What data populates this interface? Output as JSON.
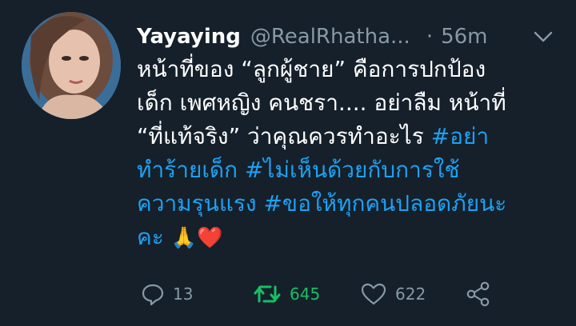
{
  "tweet": {
    "author_name": "Yayaying",
    "handle": "@RealRhatha...",
    "separator": "·",
    "time": "56m",
    "lines": [
      {
        "text": "หน้าที่ของ “ลูกผู้ชาย” คือการปกป้อง"
      },
      {
        "text": "เด็ก เพศหญิง คนชรา.... อย่าลืม หน้าที่"
      },
      {
        "text": "“ที่แท้จริง” ว่าคุณควรทำอะไร ",
        "tag": "#อย่า"
      },
      {
        "tag": "ทำร้ายเด็ก #ไม่เห็นด้วยกับการใช้"
      },
      {
        "tag": "ความรุนแรง #ขอให้ทุกคนปลอดภัยนะ"
      },
      {
        "tag": "คะ",
        "emoji": "🙏❤️"
      }
    ]
  },
  "actions": {
    "reply_count": "13",
    "retweet_count": "645",
    "like_count": "622"
  },
  "icons": {
    "reply": "reply-icon",
    "retweet": "retweet-icon",
    "like": "heart-icon",
    "share": "share-icon",
    "menu": "chevron-down-icon"
  },
  "colors": {
    "background": "#15202b",
    "secondary_text": "#8899a6",
    "hashtag": "#1da1f2",
    "retweet_active": "#17bf63"
  }
}
